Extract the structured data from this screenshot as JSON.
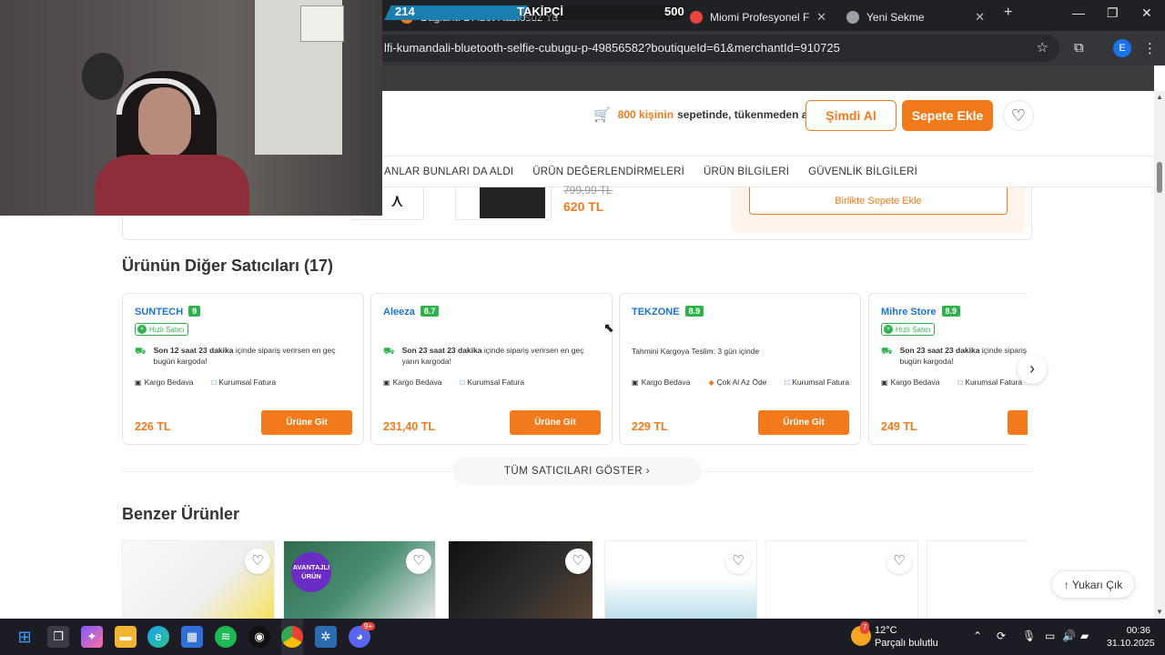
{
  "browser": {
    "tabs": [
      {
        "label": "Bağlantı 2 Adet Kablosuz Ya"
      },
      {
        "label": "Miomi Profesyonel Fotoğr"
      },
      {
        "label": "Yeni Sekme"
      }
    ],
    "new_tab_label": "+",
    "url": "lfi-kumandali-bluetooth-selfie-cubugu-p-49856582?boutiqueId=61&merchantId=910725",
    "profile_initial": "E"
  },
  "stream_overlay": {
    "follower_count": "214",
    "label": "TAKİPÇİ",
    "goal": "500"
  },
  "sticky_header": {
    "basket_count": "800 kişinin",
    "basket_rest": "sepetinde, tükenmeden al!",
    "buy_now_label": "Şimdi Al",
    "add_to_cart_label": "Sepete Ekle",
    "nav": [
      "ANLAR BUNLARI DA ALDI",
      "ÜRÜN DEĞERLENDİRMELERİ",
      "ÜRÜN BİLGİLERİ",
      "GÜVENLİK BİLGİLERİ"
    ]
  },
  "bundle": {
    "old_price": "799,99 TL",
    "new_price": "620 TL",
    "add_together_label": "Birlikte Sepete Ekle"
  },
  "sellers": {
    "title": "Ürünün Diğer Satıcıları (17)",
    "fast_seller_label": "Hızlı Satıcı",
    "go_label": "Ürüne Git",
    "free_shipping": "Kargo Bedava",
    "corporate_invoice": "Kurumsal Fatura",
    "cards": [
      {
        "name": "SUNTECH",
        "score": "9",
        "ship_bold": "Son 12 saat 23 dakika",
        "ship_rest": " içinde sipariş verirsen en geç bugün kargoda!",
        "price": "226 TL"
      },
      {
        "name": "Aleeza",
        "score": "8.7",
        "ship_bold": "Son 23 saat 23 dakika",
        "ship_rest": " içinde sipariş verirsen en geç yarın kargoda!",
        "price": "231,40 TL"
      },
      {
        "name": "TEKZONE",
        "score": "8.9",
        "ship_text": "Tahmini Kargoya Teslim:   3 gün içinde",
        "extra_tag": "Çok Al Az Öde",
        "price": "229 TL"
      },
      {
        "name": "Mihre Store",
        "score": "8.9",
        "ship_bold": "Son 23 saat 23 dakika",
        "ship_rest": " içinde sipariş verirsen en geç bugün kargoda!",
        "price": "249 TL"
      }
    ],
    "all_sellers_label": "TÜM SATICILARI GÖSTER ›"
  },
  "similar": {
    "title": "Benzer Ürünler",
    "advantage_badge": "AVANTAJLI ÜRÜN"
  },
  "scroll_top_label": "Yukarı Çık",
  "taskbar": {
    "weather_temp": "12°C",
    "weather_desc": "Parçalı bulutlu",
    "weather_badge": "7",
    "discord_badge": "9+",
    "time": "00:36",
    "date": "31.10.2025"
  },
  "colors": {
    "accent": "#f27a1a",
    "seller_link": "#1a73d9",
    "score_green": "#2fb24c"
  }
}
